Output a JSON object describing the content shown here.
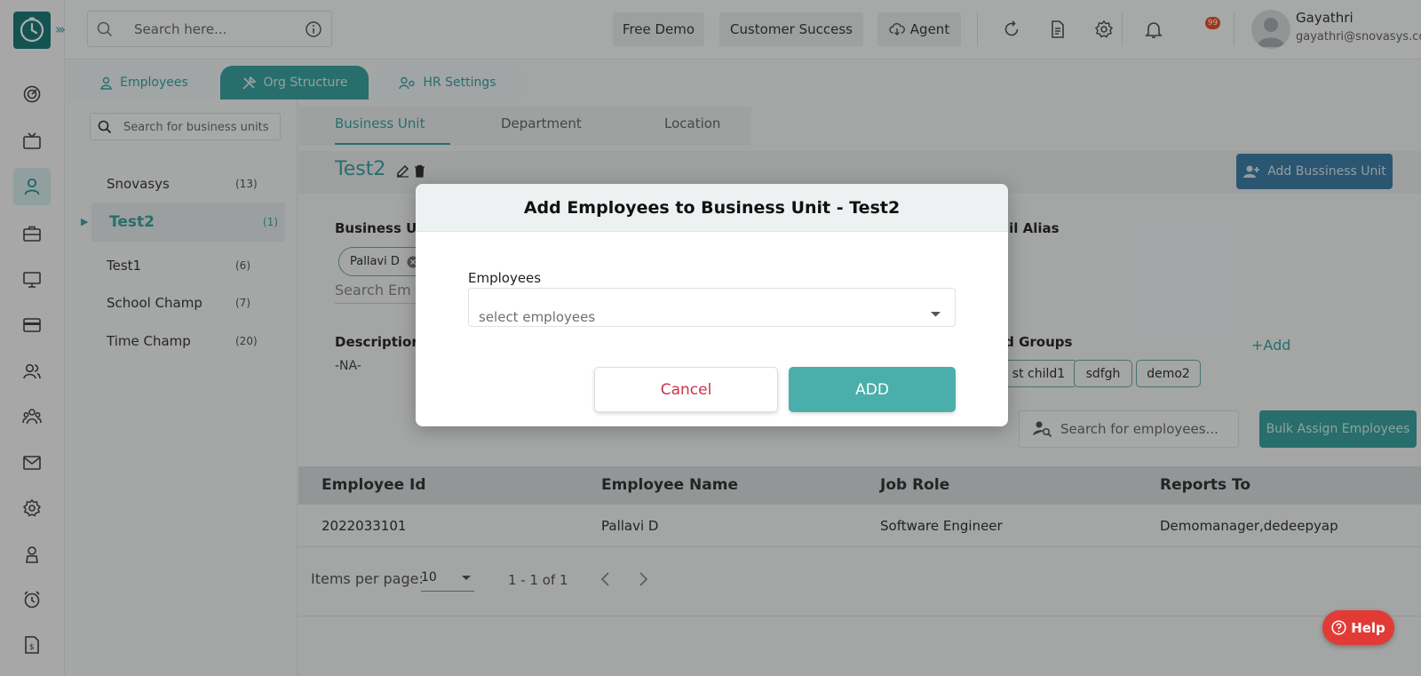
{
  "app": {
    "brand_color": "#1d7c7a",
    "accent_color": "#3aa39f"
  },
  "topbar": {
    "search_placeholder": "Search here...",
    "free_demo": "Free Demo",
    "customer_success": "Customer Success",
    "agent": "Agent",
    "notification_count": "99",
    "user_name": "Gayathri",
    "user_email": "gayathri@snovasys.com"
  },
  "module_tabs": [
    {
      "label": "Employees",
      "icon": "person-icon"
    },
    {
      "label": "Org Structure",
      "icon": "tools-icon"
    },
    {
      "label": "HR Settings",
      "icon": "people-settings-icon"
    }
  ],
  "business_units": {
    "search_placeholder": "Search for business units",
    "items": [
      {
        "name": "Snovasys",
        "count": "(13)"
      },
      {
        "name": "Test2",
        "count": "(1)"
      },
      {
        "name": "Test1",
        "count": "(6)"
      },
      {
        "name": "School Champ",
        "count": "(7)"
      },
      {
        "name": "Time Champ",
        "count": "(20)"
      }
    ]
  },
  "sub_tabs": [
    "Business Unit",
    "Department",
    "Location"
  ],
  "detail": {
    "title": "Test2",
    "add_button": "Add Bussiness Unit",
    "business_unit_label": "Business Uni",
    "head_chip": "Pallavi D",
    "search_employee_text": "Search Em",
    "description_label": "Description",
    "description_value": "-NA-",
    "email_alias_label": "ail Alias",
    "email_alias_value": "-",
    "child_groups_label": "ld Groups",
    "add_link": "+Add",
    "groups": [
      "st child1",
      "sdfgh",
      "demo2"
    ],
    "employee_search_placeholder": "Search for employees...",
    "bulk_assign": "Bulk Assign Employees"
  },
  "table": {
    "headers": [
      "Employee Id",
      "Employee Name",
      "Job Role",
      "Reports To"
    ],
    "rows": [
      [
        "2022033101",
        "Pallavi D",
        "Software Engineer",
        "Demomanager,dedeepyap"
      ]
    ],
    "items_per_page_label": "Items per page:",
    "items_per_page": "10",
    "range": "1 - 1 of 1"
  },
  "modal": {
    "title": "Add Employees to Business Unit - Test2",
    "field_label": "Employees",
    "placeholder": "select employees",
    "cancel": "Cancel",
    "add": "ADD"
  },
  "help": {
    "label": "Help"
  }
}
